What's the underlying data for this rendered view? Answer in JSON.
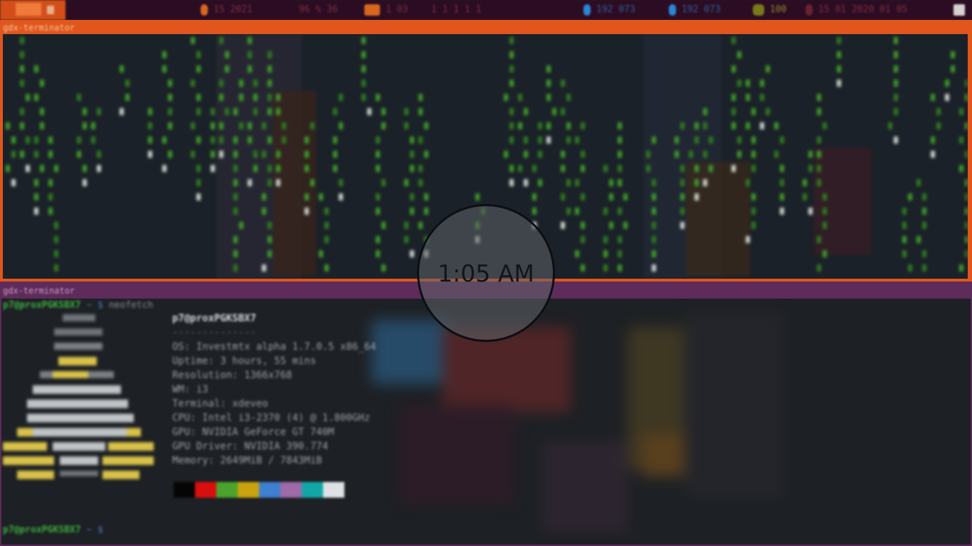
{
  "topbar": {
    "segments": [
      "15 2021",
      "96 % 36",
      "1 03",
      "1 1 1 1 1",
      "192 073",
      "192 073",
      "100",
      "15 01 2020 01 05"
    ]
  },
  "terminal_top": {
    "title": "gdx-terminator"
  },
  "terminal_bottom": {
    "title": "gdx-terminator",
    "prompt_user": "p7@proxPGKSBX7",
    "prompt_path": "~",
    "prompt_symbol": "$",
    "command": "neofetch",
    "neofetch": {
      "host": "p7@proxPGKSBX7",
      "separator": "--------------",
      "rows": [
        "OS: Investmtx alpha 1.7.0.5 x86_64",
        "Uptime: 3 hours, 55 mins",
        "Resolution: 1366x768",
        "WM: i3",
        "Terminal: xdeveo",
        "CPU: Intel i3-2370 (4) @ 1.800GHz",
        "GPU: NVIDIA GeForce GT 740M",
        "GPU Driver: NVIDIA 390.774",
        "Memory: 2649MiB / 7843MiB"
      ]
    },
    "palette": [
      "#050505",
      "#d80f0f",
      "#4aa32c",
      "#c9a30e",
      "#3f7fcf",
      "#9e6aa8",
      "#12a7a7",
      "#dfe2e4"
    ]
  },
  "clock": {
    "time": "1:05 AM"
  }
}
